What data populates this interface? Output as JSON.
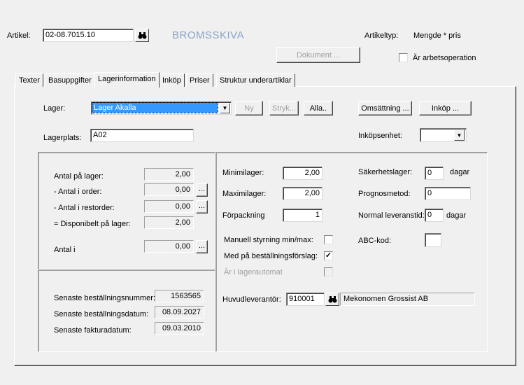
{
  "header": {
    "artikel_label": "Artikel:",
    "artikel_value": "02-08.7015.10",
    "article_name": "BROMSSKIVA",
    "artikeltyp_label": "Artikeltyp:",
    "artikeltyp_value": "Mengde * pris",
    "dokument_button": "Dokument ...",
    "arbetsoperation_label": "Är arbetsoperation",
    "arbetsoperation_checked": false
  },
  "tabs": [
    {
      "label": "Texter"
    },
    {
      "label": "Basuppgifter"
    },
    {
      "label": "Lagerinformation",
      "active": true
    },
    {
      "label": "Inköp"
    },
    {
      "label": "Priser"
    },
    {
      "label": "Struktur underartiklar"
    }
  ],
  "lager": {
    "label": "Lager:",
    "selected": "Lager Akalla",
    "ny_button": "Ny",
    "stryk_button": "Stryk...",
    "alla_button": "Alla..",
    "omsattning_button": "Omsättning ...",
    "inkop_button": "Inköp ...",
    "lagerplats_label": "Lagerplats:",
    "lagerplats_value": "A02",
    "inkopsenhet_label": "Inköpsenhet:",
    "inkopsenhet_value": ""
  },
  "stock": {
    "antal_pa_lager_label": "Antal på lager:",
    "antal_pa_lager": "2,00",
    "antal_i_order_label": "- Antal i order:",
    "antal_i_order": "0,00",
    "antal_i_restorder_label": "- Antal i restorder:",
    "antal_i_restorder": "0,00",
    "disponibelt_label": "= Disponibelt på lager:",
    "disponibelt": "2,00",
    "antal_i_label": "Antal i",
    "antal_i": "0,00",
    "dots": "..."
  },
  "history": {
    "bestallningsnummer_label": "Senaste beställningsnummer:",
    "bestallningsnummer": "1563565",
    "bestallningsdatum_label": "Senaste beställningsdatum:",
    "bestallningsdatum": "08.09.2027",
    "fakturadatum_label": "Senaste fakturadatum:",
    "fakturadatum": "09.03.2010"
  },
  "settings": {
    "minimilager_label": "Minimilager:",
    "minimilager": "2,00",
    "maximilager_label": "Maximilager:",
    "maximilager": "2,00",
    "forpackning_label": "Förpackning",
    "forpackning": "1",
    "sakerhetslager_label": "Säkerhetslager:",
    "sakerhetslager": "0",
    "dagar1": "dagar",
    "prognosmetod_label": "Prognosmetod:",
    "prognosmetod": "0",
    "leveranstid_label": "Normal leveranstid:",
    "leveranstid": "0",
    "dagar2": "dagar",
    "manuell_label": "Manuell styrning min/max:",
    "manuell_checked": false,
    "med_pa_label": "Med på beställningsförslag:",
    "med_pa_checked": true,
    "lagerautomat_label": "Är i lagerautomat",
    "lagerautomat_checked": false,
    "abc_label": "ABC-kod:",
    "abc_value": "",
    "huvudleverantor_label": "Huvudleverantör:",
    "huvudleverantor_id": "910001",
    "huvudleverantor_name": "Mekonomen Grossist AB",
    "check_mark": "✓"
  }
}
